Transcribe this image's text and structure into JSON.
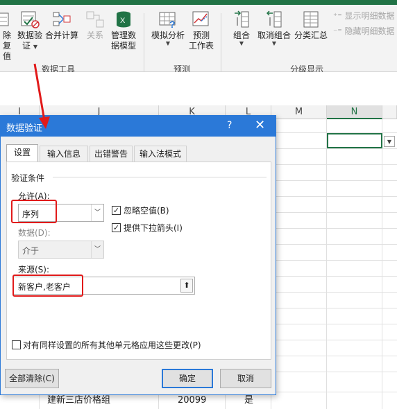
{
  "ribbon": {
    "left_partial": {
      "line1": "除",
      "line2": "复值"
    },
    "data_validation": {
      "line1": "数据验",
      "line2": "证"
    },
    "consolidate": "合并计算",
    "relationships": "关系",
    "manage_model": {
      "line1": "管理数",
      "line2": "据模型"
    },
    "data_tools_label": "数据工具",
    "what_if": "模拟分析",
    "forecast": {
      "line1": "预测",
      "line2": "工作表"
    },
    "forecast_label": "预测",
    "group": "组合",
    "ungroup": "取消组合",
    "subtotal": "分类汇总",
    "outline_label": "分级显示",
    "show_detail": "显示明细数据",
    "hide_detail": "隐藏明细数据"
  },
  "sheet": {
    "columns": [
      "I",
      "J",
      "K",
      "L",
      "M",
      "N"
    ],
    "last_row": {
      "j": "建新三店价格组",
      "k": "20099",
      "l": "是"
    }
  },
  "dialog": {
    "title": "数据验证",
    "help": "?",
    "close": "✕",
    "tabs": [
      "设置",
      "输入信息",
      "出错警告",
      "输入法模式"
    ],
    "section_label": "验证条件",
    "allow_label": "允许(A):",
    "allow_value": "序列",
    "data_label": "数据(D):",
    "data_value": "介于",
    "ignore_blank": "忽略空值(B)",
    "in_cell_dropdown": "提供下拉箭头(I)",
    "source_label": "来源(S):",
    "source_value": "新客户,老客户",
    "apply_all": "对有同样设置的所有其他单元格应用这些更改(P)",
    "clear_all": "全部清除(C)",
    "ok": "确定",
    "cancel": "取消"
  },
  "colors": {
    "excel_green": "#217346",
    "dialog_blue": "#2b79d8",
    "annotation_red": "#e11a1a"
  }
}
